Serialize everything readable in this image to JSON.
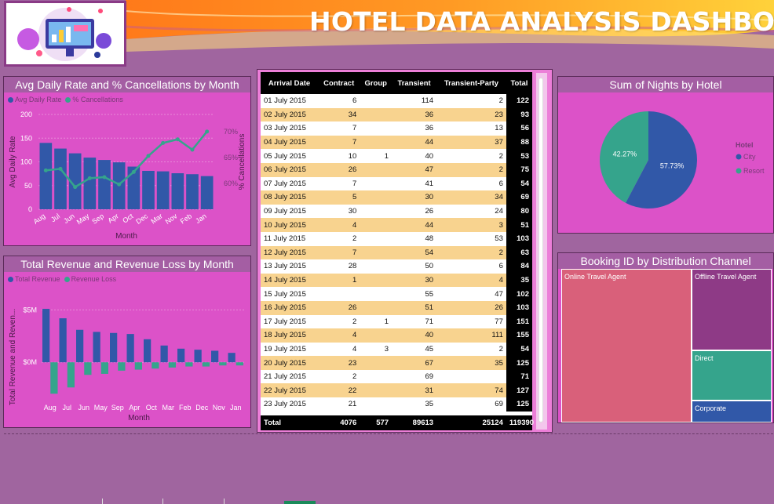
{
  "dashboard": {
    "title": "HOTEL DATA ANALYSIS DASHBOARD"
  },
  "colors": {
    "blue": "#3158a8",
    "green": "#35a48c",
    "panel": "#dc52c8",
    "header": "#a45ea3",
    "bg": "#a0659f"
  },
  "chart_data": [
    {
      "type": "bar",
      "title": "Avg Daily Rate and % Cancellations by Month",
      "xlabel": "Month",
      "ylabel": "Avg Daily Rate",
      "y2label": "% Cancellations",
      "categories": [
        "Aug",
        "Jul",
        "Jun",
        "May",
        "Sep",
        "Apr",
        "Oct",
        "Dec",
        "Mar",
        "Nov",
        "Feb",
        "Jan"
      ],
      "ylim": [
        0,
        200
      ],
      "y2lim": [
        55,
        73.3
      ],
      "yticks": [
        "0",
        "50",
        "100",
        "150",
        "200"
      ],
      "y2ticks": [
        "60%",
        "65%",
        "70%"
      ],
      "series": [
        {
          "name": "Avg Daily Rate",
          "kind": "bar",
          "values": [
            140,
            128,
            118,
            109,
            104,
            99,
            90,
            81,
            80,
            76,
            74,
            70
          ]
        },
        {
          "name": "% Cancellations",
          "kind": "line",
          "values": [
            62.5,
            62.8,
            59.3,
            61.0,
            61.2,
            59.8,
            62.2,
            65.3,
            67.8,
            68.5,
            66.5,
            70.0
          ]
        }
      ]
    },
    {
      "type": "bar",
      "title": "Total Revenue and Revenue Loss by Month",
      "xlabel": "Month",
      "ylabel": "Total Revenue and Reven...",
      "categories": [
        "Aug",
        "Jul",
        "Jun",
        "May",
        "Sep",
        "Apr",
        "Oct",
        "Mar",
        "Feb",
        "Dec",
        "Nov",
        "Jan"
      ],
      "ylim": [
        -3.5,
        6
      ],
      "yticks": [
        "$0M",
        "$5M"
      ],
      "series": [
        {
          "name": "Total Revenue",
          "values": [
            5.1,
            4.2,
            3.1,
            2.9,
            2.8,
            2.7,
            2.2,
            1.6,
            1.3,
            1.2,
            1.1,
            0.9
          ]
        },
        {
          "name": "Revenue Loss",
          "values": [
            -3.0,
            -2.4,
            -1.2,
            -1.1,
            -0.8,
            -0.7,
            -0.6,
            -0.5,
            -0.4,
            -0.4,
            -0.3,
            -0.3
          ]
        }
      ]
    },
    {
      "type": "pie",
      "title": "Sum of Nights by Hotel",
      "legend_title": "Hotel",
      "slices": [
        {
          "name": "City",
          "value": 57.73,
          "label": "57.73%"
        },
        {
          "name": "Resort",
          "value": 42.27,
          "label": "42.27%"
        }
      ]
    },
    {
      "type": "treemap",
      "title": "Booking ID by Distribution Channel",
      "items": [
        {
          "name": "Online Travel Agent"
        },
        {
          "name": "Offline Travel Agent"
        },
        {
          "name": "Direct"
        },
        {
          "name": "Corporate"
        }
      ]
    }
  ],
  "table": {
    "columns": [
      "Arrival Date",
      "Contract",
      "Group",
      "Transient",
      "Transient-Party",
      "Total"
    ],
    "rows": [
      [
        "01 July 2015",
        "6",
        "",
        "114",
        "2",
        "122"
      ],
      [
        "02 July 2015",
        "34",
        "",
        "36",
        "23",
        "93"
      ],
      [
        "03 July 2015",
        "7",
        "",
        "36",
        "13",
        "56"
      ],
      [
        "04 July 2015",
        "7",
        "",
        "44",
        "37",
        "88"
      ],
      [
        "05 July 2015",
        "10",
        "1",
        "40",
        "2",
        "53"
      ],
      [
        "06 July 2015",
        "26",
        "",
        "47",
        "2",
        "75"
      ],
      [
        "07 July 2015",
        "7",
        "",
        "41",
        "6",
        "54"
      ],
      [
        "08 July 2015",
        "5",
        "",
        "30",
        "34",
        "69"
      ],
      [
        "09 July 2015",
        "30",
        "",
        "26",
        "24",
        "80"
      ],
      [
        "10 July 2015",
        "4",
        "",
        "44",
        "3",
        "51"
      ],
      [
        "11 July 2015",
        "2",
        "",
        "48",
        "53",
        "103"
      ],
      [
        "12 July 2015",
        "7",
        "",
        "54",
        "2",
        "63"
      ],
      [
        "13 July 2015",
        "28",
        "",
        "50",
        "6",
        "84"
      ],
      [
        "14 July 2015",
        "1",
        "",
        "30",
        "4",
        "35"
      ],
      [
        "15 July 2015",
        "",
        "",
        "55",
        "47",
        "102"
      ],
      [
        "16 July 2015",
        "26",
        "",
        "51",
        "26",
        "103"
      ],
      [
        "17 July 2015",
        "2",
        "1",
        "71",
        "77",
        "151"
      ],
      [
        "18 July 2015",
        "4",
        "",
        "40",
        "111",
        "155"
      ],
      [
        "19 July 2015",
        "4",
        "3",
        "45",
        "2",
        "54"
      ],
      [
        "20 July 2015",
        "23",
        "",
        "67",
        "35",
        "125"
      ],
      [
        "21 July 2015",
        "2",
        "",
        "69",
        "",
        "71"
      ],
      [
        "22 July 2015",
        "22",
        "",
        "31",
        "74",
        "127"
      ],
      [
        "23 July 2015",
        "21",
        "",
        "35",
        "69",
        "125"
      ]
    ],
    "total": [
      "Total",
      "4076",
      "577",
      "89613",
      "25124",
      "119390"
    ]
  }
}
